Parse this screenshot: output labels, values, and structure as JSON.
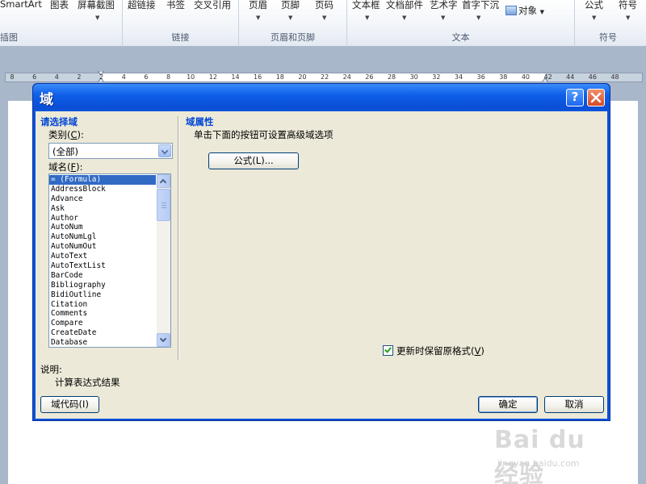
{
  "ribbon": {
    "items": [
      {
        "label": "SmartArt"
      },
      {
        "label": "图表"
      },
      {
        "label": "屏幕截图"
      },
      {
        "label": "超链接"
      },
      {
        "label": "书签"
      },
      {
        "label": "交叉引用"
      },
      {
        "label": "页眉"
      },
      {
        "label": "页脚"
      },
      {
        "label": "页码"
      },
      {
        "label": "文本框"
      },
      {
        "label": "文档部件"
      },
      {
        "label": "艺术字"
      },
      {
        "label": "首字下沉"
      },
      {
        "label": "对象"
      },
      {
        "label": "公式"
      },
      {
        "label": "符号"
      }
    ],
    "groups": [
      {
        "label": "插图"
      },
      {
        "label": "链接"
      },
      {
        "label": "页眉和页脚"
      },
      {
        "label": "文本"
      },
      {
        "label": "符号"
      }
    ]
  },
  "ruler": {
    "ticks": [
      "8",
      "6",
      "4",
      "2",
      "2",
      "4",
      "6",
      "8",
      "10",
      "12",
      "14",
      "16",
      "18",
      "20",
      "22",
      "24",
      "26",
      "28",
      "30",
      "32",
      "34",
      "36",
      "38",
      "40",
      "42",
      "44",
      "46",
      "48"
    ]
  },
  "dialog": {
    "title": "域",
    "help_label": "?",
    "left_group_title": "请选择域",
    "category_label": "类别",
    "category_key": "C",
    "category_value": "(全部)",
    "fieldname_label": "域名",
    "fieldname_key": "F",
    "field_names": [
      "= (Formula)",
      "AddressBlock",
      "Advance",
      "Ask",
      "Author",
      "AutoNum",
      "AutoNumLgl",
      "AutoNumOut",
      "AutoText",
      "AutoTextList",
      "BarCode",
      "Bibliography",
      "BidiOutline",
      "Citation",
      "Comments",
      "Compare",
      "CreateDate",
      "Database"
    ],
    "right_group_title": "域属性",
    "hint_text": "单击下面的按钮可设置高级域选项",
    "formula_button": "公式(L)...",
    "preserve_label": "更新时保留原格式",
    "preserve_key": "V",
    "preserve_checked": true,
    "desc_label": "说明:",
    "desc_text": "计算表达式结果",
    "field_codes_button": "域代码(I)",
    "ok_button": "确定",
    "cancel_button": "取消"
  },
  "watermark": {
    "logo": "Bai du 经验",
    "url": "jingyan.baidu.com"
  },
  "colors": {
    "title_blue": "#0a4fd6",
    "group_title": "#0046d5",
    "selection": "#316ac5",
    "dialog_face": "#ece9d8"
  }
}
